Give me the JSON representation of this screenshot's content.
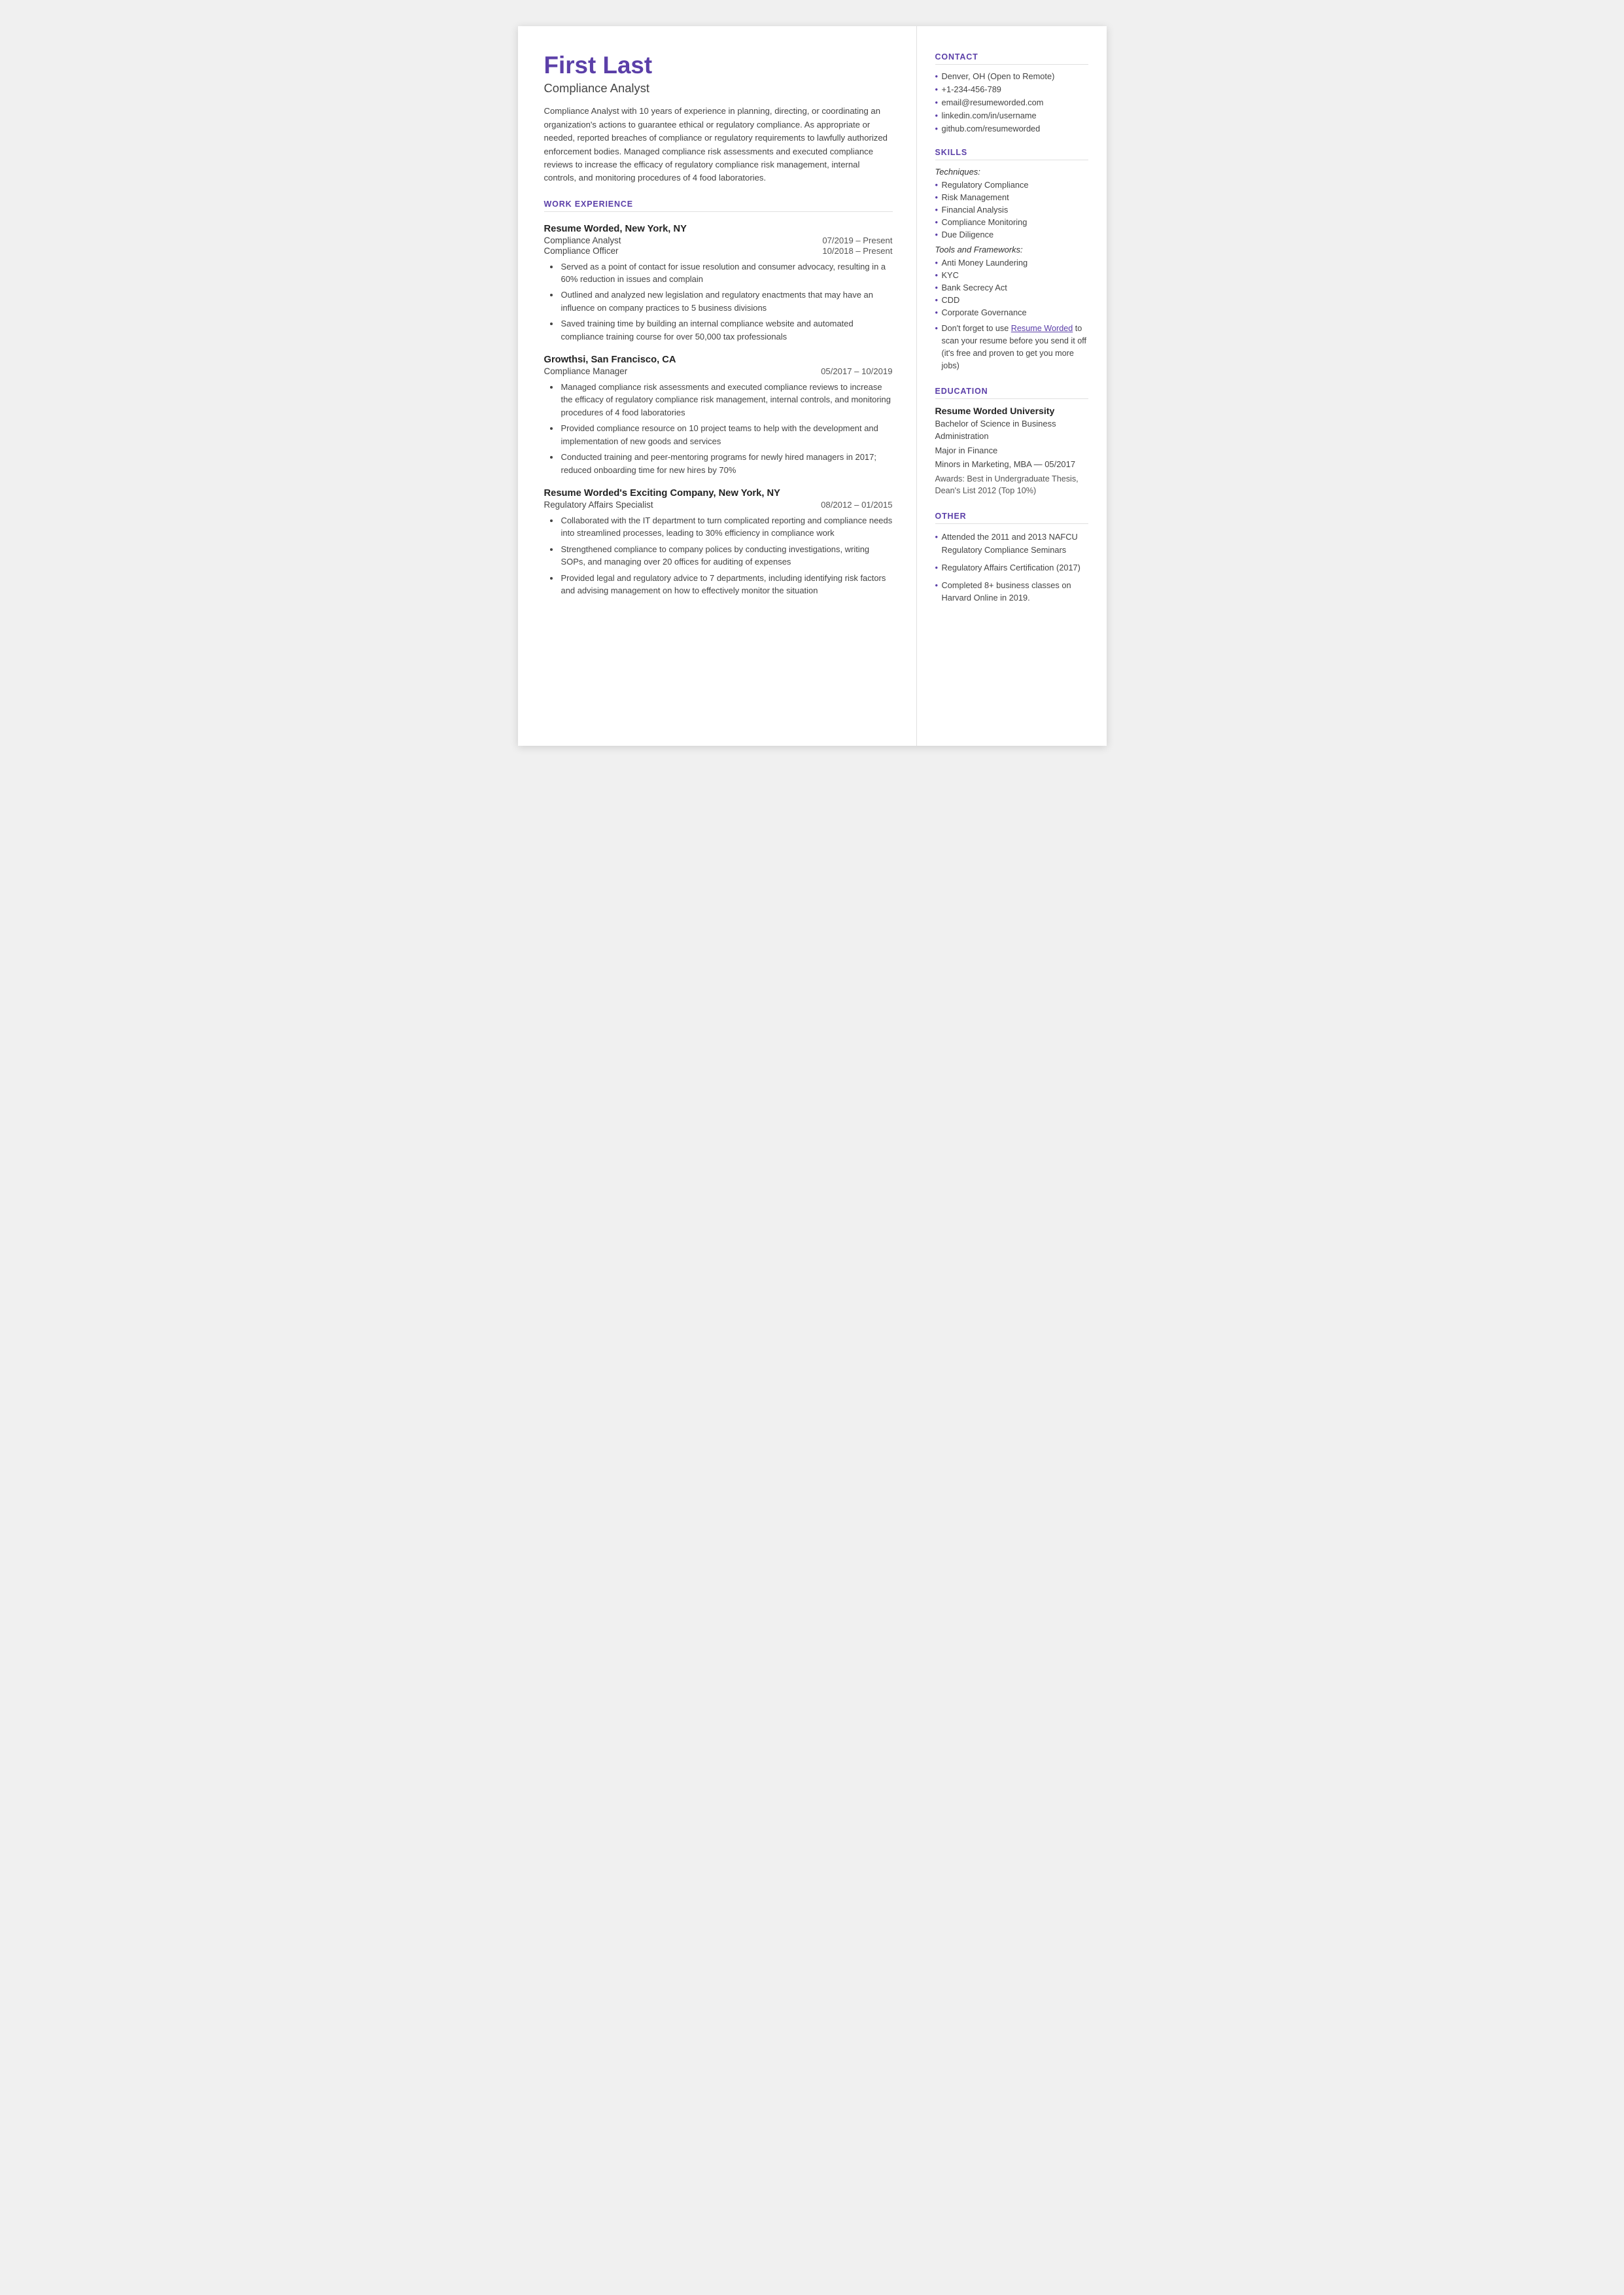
{
  "header": {
    "name": "First Last",
    "title": "Compliance Analyst",
    "summary": "Compliance Analyst with 10 years of experience in planning, directing, or coordinating an organization's actions to guarantee ethical or regulatory compliance. As appropriate or needed, reported breaches of compliance or regulatory requirements to lawfully authorized enforcement bodies. Managed compliance risk assessments and executed compliance reviews to increase the efficacy of regulatory compliance risk management, internal controls, and monitoring procedures of 4 food laboratories."
  },
  "sections": {
    "work_experience_label": "WORK EXPERIENCE",
    "contact_label": "CONTACT",
    "skills_label": "SKILLS",
    "education_label": "EDUCATION",
    "other_label": "OTHER"
  },
  "work": [
    {
      "company": "Resume Worded, New York, NY",
      "roles": [
        {
          "title": "Compliance Analyst",
          "date": "07/2019 – Present"
        },
        {
          "title": "Compliance Officer",
          "date": "10/2018 – Present"
        }
      ],
      "bullets": [
        "Served as a point of contact for issue resolution and consumer advocacy, resulting in a 60% reduction in issues and complain",
        "Outlined and analyzed new legislation and regulatory enactments that may have an influence on company practices to 5 business divisions",
        "Saved training time by building an internal compliance website and automated compliance training course for over 50,000 tax professionals"
      ]
    },
    {
      "company": "Growthsi, San Francisco, CA",
      "roles": [
        {
          "title": "Compliance Manager",
          "date": "05/2017 – 10/2019"
        }
      ],
      "bullets": [
        "Managed compliance risk assessments and executed compliance reviews to increase the efficacy of regulatory compliance risk management, internal controls, and monitoring procedures of 4 food laboratories",
        "Provided compliance resource on 10 project teams to help with the development and implementation of new goods and services",
        "Conducted training and peer-mentoring programs for newly hired managers in 2017; reduced onboarding time for new hires by 70%"
      ]
    },
    {
      "company": "Resume Worded's Exciting Company, New York, NY",
      "roles": [
        {
          "title": "Regulatory Affairs Specialist",
          "date": "08/2012 – 01/2015"
        }
      ],
      "bullets": [
        "Collaborated with the IT department to turn complicated reporting and compliance needs into streamlined processes, leading to 30% efficiency in compliance work",
        "Strengthened compliance to company polices by conducting investigations, writing SOPs, and managing over 20 offices for auditing of expenses",
        "Provided legal and regulatory advice to 7 departments, including identifying risk factors and advising management on how to effectively monitor the situation"
      ]
    }
  ],
  "contact": {
    "items": [
      "Denver, OH (Open to Remote)",
      "+1-234-456-789",
      "email@resumeworded.com",
      "linkedin.com/in/username",
      "github.com/resumeworded"
    ]
  },
  "skills": {
    "techniques_label": "Techniques:",
    "techniques": [
      "Regulatory Compliance",
      "Risk Management",
      "Financial Analysis",
      "Compliance Monitoring",
      "Due Diligence"
    ],
    "tools_label": "Tools and Frameworks:",
    "tools": [
      "Anti Money Laundering",
      "KYC",
      "Bank Secrecy Act",
      "CDD",
      "Corporate Governance"
    ],
    "note": "Don't forget to use Resume Worded to scan your resume before you send it off (it's free and proven to get you more jobs)",
    "note_link_text": "Resume Worded",
    "note_link_href": "https://resumeworded.com"
  },
  "education": {
    "school": "Resume Worded University",
    "degree": "Bachelor of Science in Business Administration",
    "major": "Major in Finance",
    "minors": "Minors in Marketing, MBA — 05/2017",
    "awards": "Awards: Best in Undergraduate Thesis, Dean's List 2012 (Top 10%)"
  },
  "other": {
    "items": [
      "Attended the 2011 and 2013 NAFCU Regulatory Compliance Seminars",
      "Regulatory Affairs Certification (2017)",
      "Completed 8+ business classes on Harvard Online in 2019."
    ]
  }
}
